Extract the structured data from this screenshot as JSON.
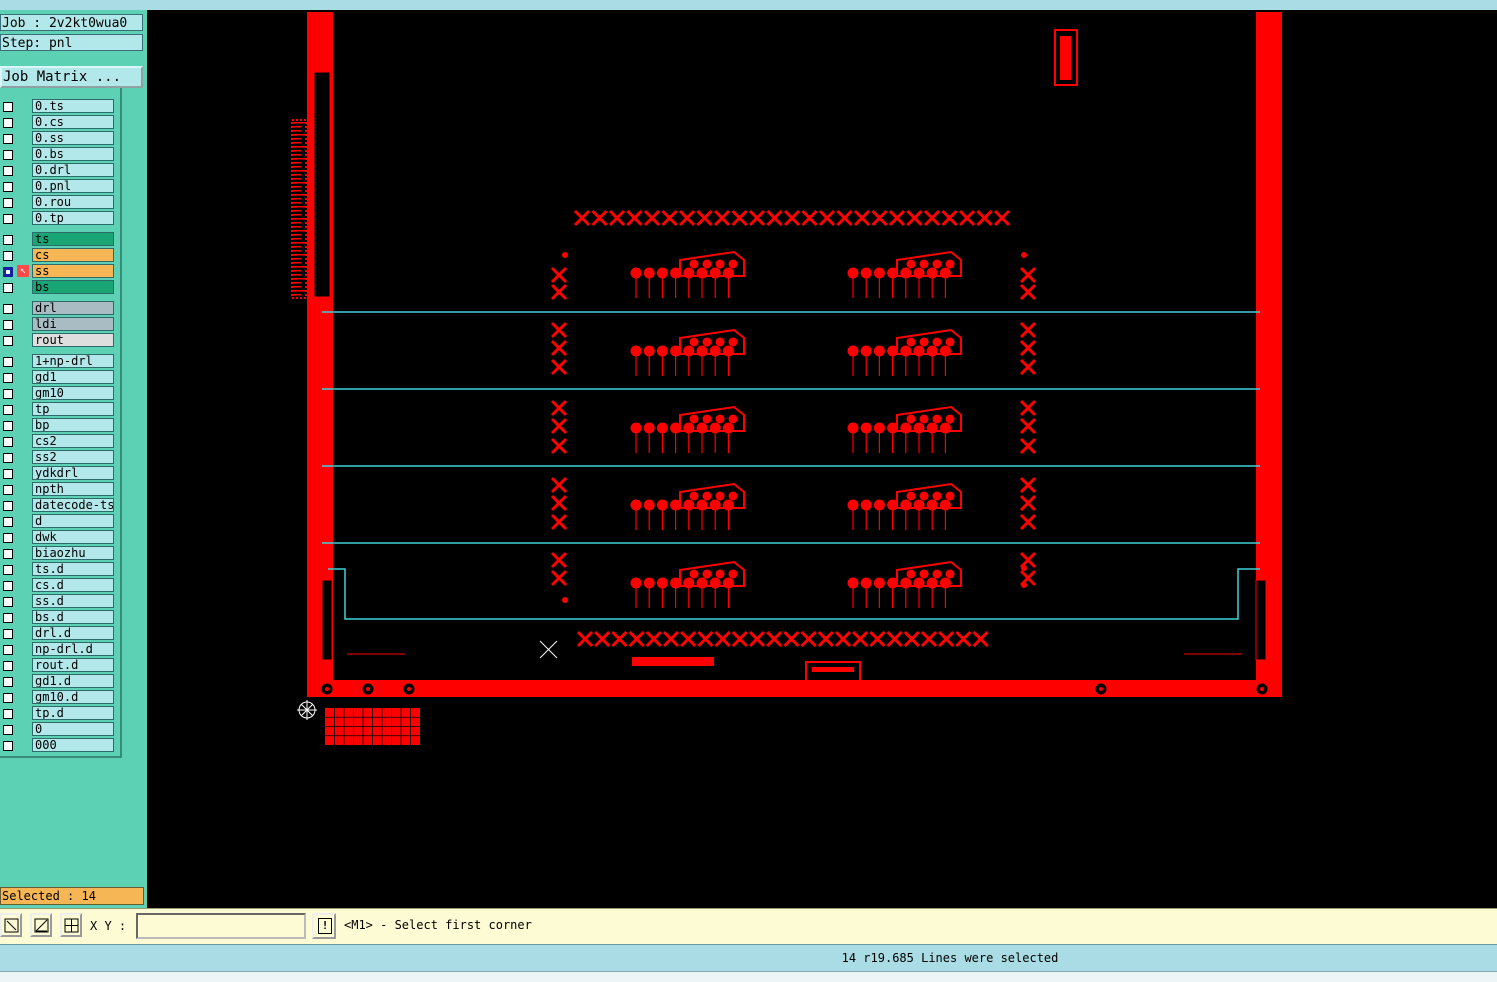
{
  "job": {
    "label": "Job : 2v2kt0wua0",
    "step": "Step: pnl",
    "matrix_button": "Job Matrix ..."
  },
  "layers": [
    {
      "name": "0.ts",
      "color": "#b3e8ea"
    },
    {
      "name": "0.cs",
      "color": "#b3e8ea"
    },
    {
      "name": "0.ss",
      "color": "#b3e8ea"
    },
    {
      "name": "0.bs",
      "color": "#b3e8ea"
    },
    {
      "name": "0.drl",
      "color": "#b3e8ea"
    },
    {
      "name": "0.pnl",
      "color": "#b3e8ea"
    },
    {
      "name": "0.rou",
      "color": "#b3e8ea"
    },
    {
      "name": "0.tp",
      "color": "#b3e8ea"
    },
    {
      "name": "ts",
      "color": "#1aa575"
    },
    {
      "name": "cs",
      "color": "#f6b655"
    },
    {
      "name": "ss",
      "color": "#f6b655",
      "active": true
    },
    {
      "name": "bs",
      "color": "#1aa575"
    },
    {
      "name": "drl",
      "color": "#a9bcc4"
    },
    {
      "name": "ldi",
      "color": "#a9bcc4"
    },
    {
      "name": "rout",
      "color": "#dedede"
    },
    {
      "name": "1+np-drl",
      "color": "#b3e8ea"
    },
    {
      "name": "gd1",
      "color": "#b3e8ea"
    },
    {
      "name": "gm10",
      "color": "#b3e8ea"
    },
    {
      "name": "tp",
      "color": "#b3e8ea"
    },
    {
      "name": "bp",
      "color": "#b3e8ea"
    },
    {
      "name": "cs2",
      "color": "#b3e8ea"
    },
    {
      "name": "ss2",
      "color": "#b3e8ea"
    },
    {
      "name": "ydkdrl",
      "color": "#b3e8ea"
    },
    {
      "name": "npth",
      "color": "#b3e8ea"
    },
    {
      "name": "datecode-ts",
      "color": "#b3e8ea"
    },
    {
      "name": "d",
      "color": "#b3e8ea"
    },
    {
      "name": "dwk",
      "color": "#b3e8ea"
    },
    {
      "name": "biaozhu",
      "color": "#b3e8ea"
    },
    {
      "name": "ts.d",
      "color": "#b3e8ea"
    },
    {
      "name": "cs.d",
      "color": "#b3e8ea"
    },
    {
      "name": "ss.d",
      "color": "#b3e8ea"
    },
    {
      "name": "bs.d",
      "color": "#b3e8ea"
    },
    {
      "name": "drl.d",
      "color": "#b3e8ea"
    },
    {
      "name": "np-drl.d",
      "color": "#b3e8ea"
    },
    {
      "name": "rout.d",
      "color": "#b3e8ea"
    },
    {
      "name": "gd1.d",
      "color": "#b3e8ea"
    },
    {
      "name": "gm10.d",
      "color": "#b3e8ea"
    },
    {
      "name": "tp.d",
      "color": "#b3e8ea"
    },
    {
      "name": "0",
      "color": "#b3e8ea"
    },
    {
      "name": "000",
      "color": "#b3e8ea"
    }
  ],
  "selected_label": "Selected : 14",
  "toolbar": {
    "xy_label": "X Y :",
    "xy_value": ""
  },
  "prompt": "<M1> - Select first corner",
  "status": "14 r19.685 Lines were selected",
  "colors": {
    "copper": "#ff0000",
    "route": "#3fd1d8",
    "canvas": "#000000"
  },
  "icons": [
    "zoom-area-icon",
    "measure-icon",
    "grid-icon",
    "alert-icon",
    "cursor-arrow-icon"
  ]
}
